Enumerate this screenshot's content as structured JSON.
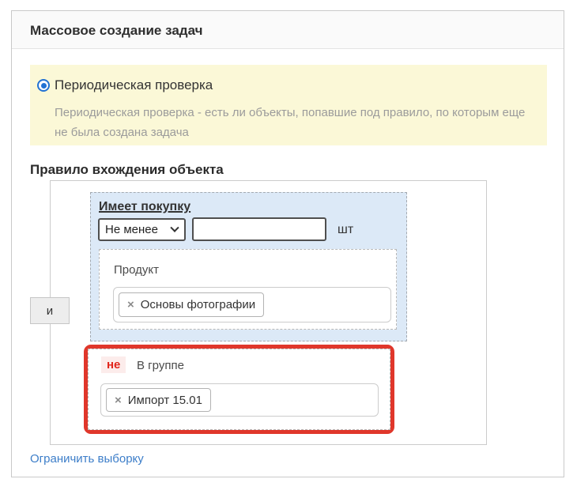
{
  "panel": {
    "title": "Массовое создание задач"
  },
  "notice": {
    "radio_label": "Периодическая проверка",
    "radio_selected": true,
    "description_line1": "Периодическая проверка - есть ли объекты, попавшие под правило, по которым еще",
    "description_line2": "не была создана задача"
  },
  "rule": {
    "section_title": "Правило вхождения объекта",
    "connector": "и",
    "purchase": {
      "title": "Имеет покупку",
      "operator_value": "Не менее",
      "amount_value": "",
      "unit": "шт",
      "product": {
        "label": "Продукт",
        "remove_icon": "×",
        "tags": [
          {
            "label": "Основы фотографии"
          }
        ]
      }
    },
    "group": {
      "not_label": "не",
      "label": "В группе",
      "remove_icon": "×",
      "tags": [
        {
          "label": "Импорт 15.01"
        }
      ]
    }
  },
  "footer": {
    "limit_link": "Ограничить выборку"
  },
  "colors": {
    "highlight_red": "#e0372b",
    "radio_blue": "#2272d3",
    "link_blue": "#3d7ec9",
    "notice_bg": "#fbf8d7",
    "condition_bg": "#dce9f7",
    "not_badge_bg": "#fceceb",
    "not_badge_text": "#e1251b"
  }
}
